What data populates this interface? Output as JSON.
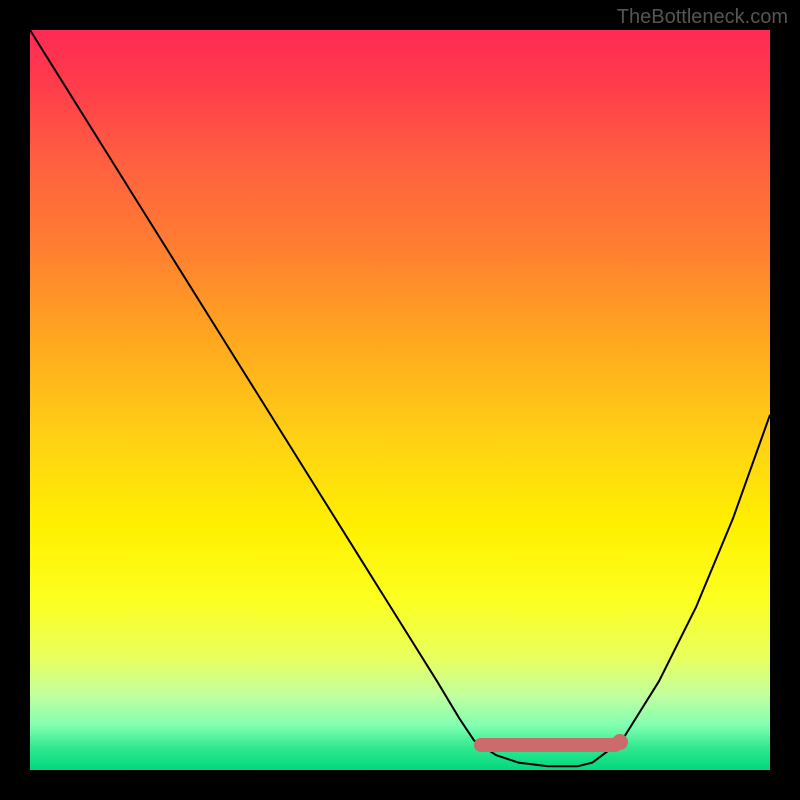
{
  "watermark": "TheBottleneck.com",
  "chart_data": {
    "type": "line",
    "title": "",
    "xlabel": "",
    "ylabel": "",
    "xlim": [
      0,
      100
    ],
    "ylim": [
      0,
      100
    ],
    "series": [
      {
        "name": "bottleneck-curve",
        "x": [
          0,
          5,
          10,
          15,
          20,
          25,
          30,
          35,
          40,
          45,
          50,
          55,
          58,
          60,
          63,
          66,
          70,
          74,
          76,
          80,
          85,
          90,
          95,
          100
        ],
        "values": [
          100,
          92,
          84,
          76,
          68,
          60,
          52,
          44,
          36,
          28,
          20,
          12,
          7,
          4,
          2,
          1,
          0.5,
          0.5,
          1,
          4,
          12,
          22,
          34,
          48
        ]
      }
    ],
    "annotations": {
      "optimal_zone": {
        "x_start": 60,
        "x_end": 80,
        "color": "#cc6b6b"
      }
    },
    "background_gradient": {
      "stops": [
        {
          "pos": 0,
          "color": "#ff2a55"
        },
        {
          "pos": 50,
          "color": "#ffd015"
        },
        {
          "pos": 100,
          "color": "#00d87e"
        }
      ]
    }
  }
}
